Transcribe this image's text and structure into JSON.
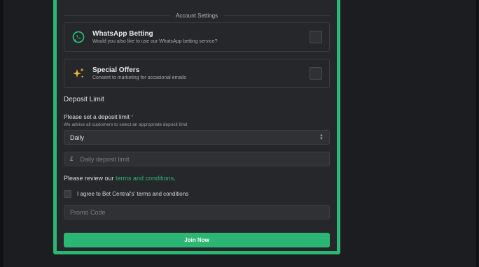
{
  "section": {
    "title": "Account Settings"
  },
  "options": [
    {
      "title": "WhatsApp Betting",
      "desc": "Would you also like to use our WhatsApp betting service?",
      "icon": "whatsapp-icon",
      "checked": false
    },
    {
      "title": "Special Offers",
      "desc": "Consent to marketing for occasional emails",
      "icon": "sparkles-icon",
      "checked": false
    }
  ],
  "deposit": {
    "heading": "Deposit Limit",
    "label": "Please set a deposit limit",
    "required_mark": "*",
    "hint": "We advise all customers to select an appropriate deposit limit",
    "period_value": "Daily",
    "currency": "£",
    "amount_placeholder": "Daily deposit limit"
  },
  "terms": {
    "prefix": "Please review our ",
    "link": "terms and conditions",
    "suffix": ".",
    "agree_label": "I agree to Bet Central's' terms and conditions"
  },
  "promo": {
    "placeholder": "Promo Code"
  },
  "join": {
    "label": "Join Now"
  },
  "colors": {
    "accent": "#2bb673",
    "background": "#1c1d20",
    "panel": "#26272a",
    "whatsapp": "#2bb673",
    "sparkle": "#f2b632"
  }
}
